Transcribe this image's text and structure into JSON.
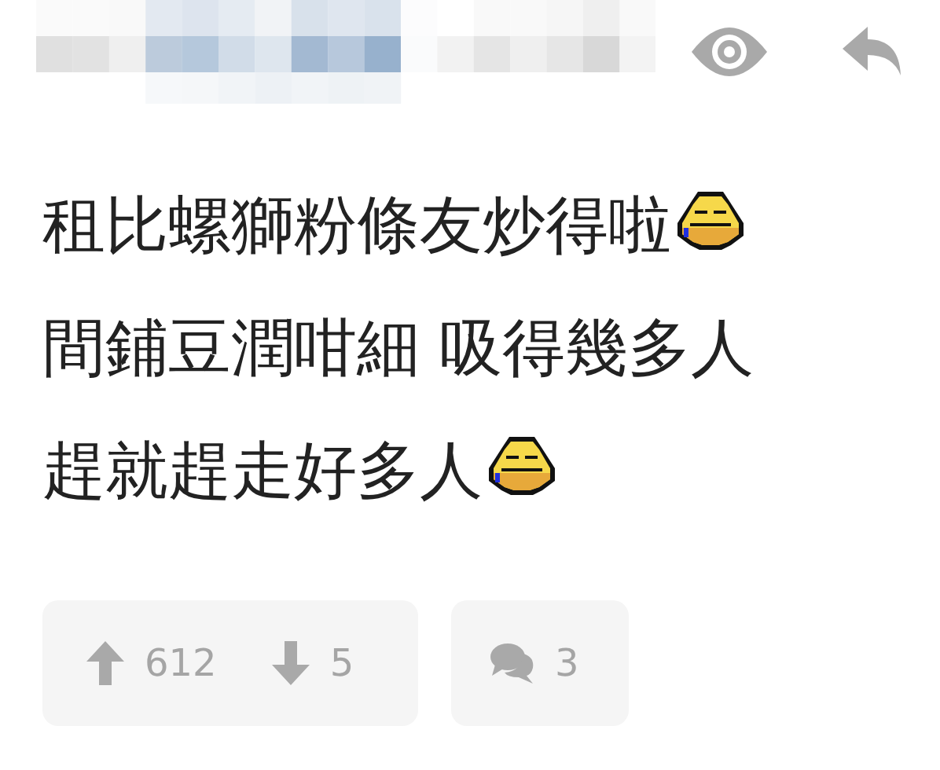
{
  "post": {
    "lines": [
      {
        "text": "租比螺獅粉條友炒得啦",
        "emoji": true
      },
      {
        "text": "間鋪豆潤咁細 吸得幾多人",
        "emoji": false
      },
      {
        "text": "趕就趕走好多人",
        "emoji": true
      }
    ]
  },
  "votes": {
    "up": "612",
    "down": "5"
  },
  "comments": {
    "count": "3"
  }
}
